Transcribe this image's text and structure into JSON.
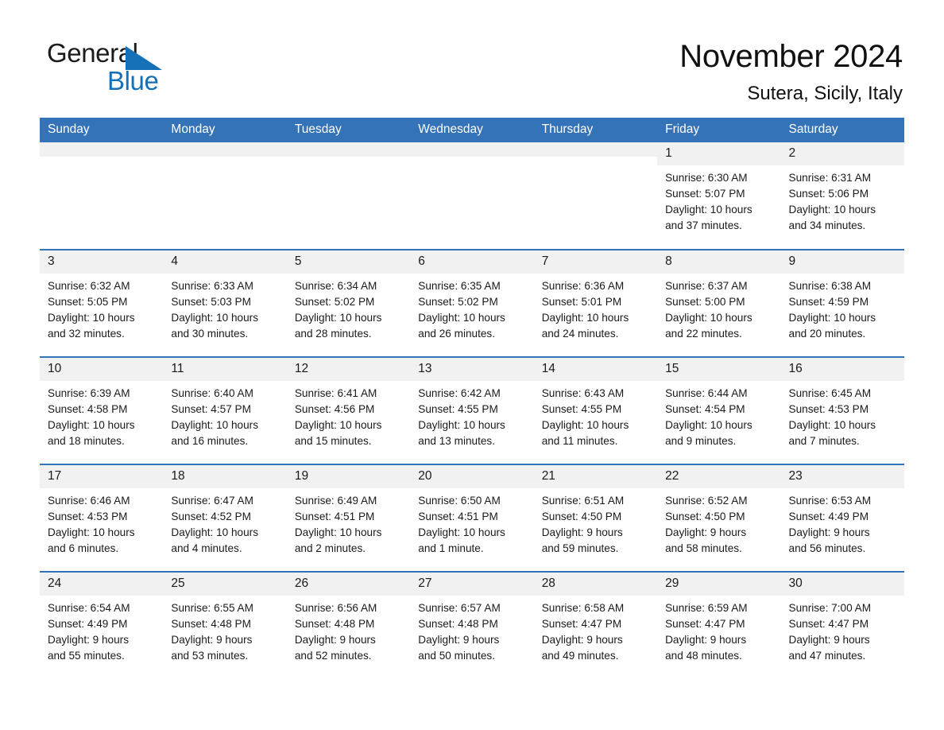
{
  "brand": {
    "name_part1": "General",
    "name_part2": "Blue",
    "logo_icon": "triangle-flag-icon",
    "accent_color": "#1570b8"
  },
  "header": {
    "title": "November 2024",
    "subtitle": "Sutera, Sicily, Italy"
  },
  "theme": {
    "header_blue": "#3573b9",
    "daynum_gray": "#f1f1f1",
    "text": "#1a1a1a"
  },
  "weekday_headers": [
    "Sunday",
    "Monday",
    "Tuesday",
    "Wednesday",
    "Thursday",
    "Friday",
    "Saturday"
  ],
  "weeks": [
    [
      {
        "day": "",
        "details": ""
      },
      {
        "day": "",
        "details": ""
      },
      {
        "day": "",
        "details": ""
      },
      {
        "day": "",
        "details": ""
      },
      {
        "day": "",
        "details": ""
      },
      {
        "day": "1",
        "details": "Sunrise: 6:30 AM\nSunset: 5:07 PM\nDaylight: 10 hours\nand 37 minutes."
      },
      {
        "day": "2",
        "details": "Sunrise: 6:31 AM\nSunset: 5:06 PM\nDaylight: 10 hours\nand 34 minutes."
      }
    ],
    [
      {
        "day": "3",
        "details": "Sunrise: 6:32 AM\nSunset: 5:05 PM\nDaylight: 10 hours\nand 32 minutes."
      },
      {
        "day": "4",
        "details": "Sunrise: 6:33 AM\nSunset: 5:03 PM\nDaylight: 10 hours\nand 30 minutes."
      },
      {
        "day": "5",
        "details": "Sunrise: 6:34 AM\nSunset: 5:02 PM\nDaylight: 10 hours\nand 28 minutes."
      },
      {
        "day": "6",
        "details": "Sunrise: 6:35 AM\nSunset: 5:02 PM\nDaylight: 10 hours\nand 26 minutes."
      },
      {
        "day": "7",
        "details": "Sunrise: 6:36 AM\nSunset: 5:01 PM\nDaylight: 10 hours\nand 24 minutes."
      },
      {
        "day": "8",
        "details": "Sunrise: 6:37 AM\nSunset: 5:00 PM\nDaylight: 10 hours\nand 22 minutes."
      },
      {
        "day": "9",
        "details": "Sunrise: 6:38 AM\nSunset: 4:59 PM\nDaylight: 10 hours\nand 20 minutes."
      }
    ],
    [
      {
        "day": "10",
        "details": "Sunrise: 6:39 AM\nSunset: 4:58 PM\nDaylight: 10 hours\nand 18 minutes."
      },
      {
        "day": "11",
        "details": "Sunrise: 6:40 AM\nSunset: 4:57 PM\nDaylight: 10 hours\nand 16 minutes."
      },
      {
        "day": "12",
        "details": "Sunrise: 6:41 AM\nSunset: 4:56 PM\nDaylight: 10 hours\nand 15 minutes."
      },
      {
        "day": "13",
        "details": "Sunrise: 6:42 AM\nSunset: 4:55 PM\nDaylight: 10 hours\nand 13 minutes."
      },
      {
        "day": "14",
        "details": "Sunrise: 6:43 AM\nSunset: 4:55 PM\nDaylight: 10 hours\nand 11 minutes."
      },
      {
        "day": "15",
        "details": "Sunrise: 6:44 AM\nSunset: 4:54 PM\nDaylight: 10 hours\nand 9 minutes."
      },
      {
        "day": "16",
        "details": "Sunrise: 6:45 AM\nSunset: 4:53 PM\nDaylight: 10 hours\nand 7 minutes."
      }
    ],
    [
      {
        "day": "17",
        "details": "Sunrise: 6:46 AM\nSunset: 4:53 PM\nDaylight: 10 hours\nand 6 minutes."
      },
      {
        "day": "18",
        "details": "Sunrise: 6:47 AM\nSunset: 4:52 PM\nDaylight: 10 hours\nand 4 minutes."
      },
      {
        "day": "19",
        "details": "Sunrise: 6:49 AM\nSunset: 4:51 PM\nDaylight: 10 hours\nand 2 minutes."
      },
      {
        "day": "20",
        "details": "Sunrise: 6:50 AM\nSunset: 4:51 PM\nDaylight: 10 hours\nand 1 minute."
      },
      {
        "day": "21",
        "details": "Sunrise: 6:51 AM\nSunset: 4:50 PM\nDaylight: 9 hours\nand 59 minutes."
      },
      {
        "day": "22",
        "details": "Sunrise: 6:52 AM\nSunset: 4:50 PM\nDaylight: 9 hours\nand 58 minutes."
      },
      {
        "day": "23",
        "details": "Sunrise: 6:53 AM\nSunset: 4:49 PM\nDaylight: 9 hours\nand 56 minutes."
      }
    ],
    [
      {
        "day": "24",
        "details": "Sunrise: 6:54 AM\nSunset: 4:49 PM\nDaylight: 9 hours\nand 55 minutes."
      },
      {
        "day": "25",
        "details": "Sunrise: 6:55 AM\nSunset: 4:48 PM\nDaylight: 9 hours\nand 53 minutes."
      },
      {
        "day": "26",
        "details": "Sunrise: 6:56 AM\nSunset: 4:48 PM\nDaylight: 9 hours\nand 52 minutes."
      },
      {
        "day": "27",
        "details": "Sunrise: 6:57 AM\nSunset: 4:48 PM\nDaylight: 9 hours\nand 50 minutes."
      },
      {
        "day": "28",
        "details": "Sunrise: 6:58 AM\nSunset: 4:47 PM\nDaylight: 9 hours\nand 49 minutes."
      },
      {
        "day": "29",
        "details": "Sunrise: 6:59 AM\nSunset: 4:47 PM\nDaylight: 9 hours\nand 48 minutes."
      },
      {
        "day": "30",
        "details": "Sunrise: 7:00 AM\nSunset: 4:47 PM\nDaylight: 9 hours\nand 47 minutes."
      }
    ]
  ]
}
